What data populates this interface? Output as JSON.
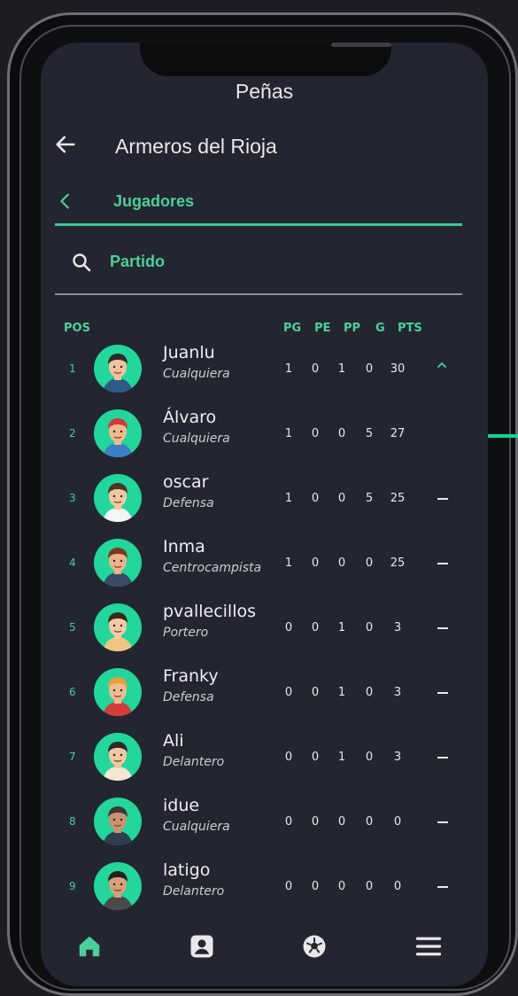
{
  "app": {
    "title": "Peñas",
    "club_name": "Armeros del Rioja"
  },
  "tabs": {
    "active_label": "Jugadores"
  },
  "search": {
    "value": "Partido"
  },
  "table": {
    "columns": {
      "pos": "POS",
      "pg": "PG",
      "pe": "PE",
      "pp": "PP",
      "g": "G",
      "pts": "PTS"
    },
    "rows": [
      {
        "pos": "1",
        "name": "Juanlu",
        "role": "Cualquiera",
        "pg": "1",
        "pe": "0",
        "pp": "1",
        "g": "0",
        "pts": "30",
        "trend": "up"
      },
      {
        "pos": "2",
        "name": "Álvaro",
        "role": "Cualquiera",
        "pg": "1",
        "pe": "0",
        "pp": "0",
        "g": "5",
        "pts": "27",
        "trend": "none"
      },
      {
        "pos": "3",
        "name": "oscar",
        "role": "Defensa",
        "pg": "1",
        "pe": "0",
        "pp": "0",
        "g": "5",
        "pts": "25",
        "trend": "same"
      },
      {
        "pos": "4",
        "name": "Inma",
        "role": "Centrocampista",
        "pg": "1",
        "pe": "0",
        "pp": "0",
        "g": "0",
        "pts": "25",
        "trend": "same"
      },
      {
        "pos": "5",
        "name": "pvallecillos",
        "role": "Portero",
        "pg": "0",
        "pe": "0",
        "pp": "1",
        "g": "0",
        "pts": "3",
        "trend": "same"
      },
      {
        "pos": "6",
        "name": "Franky",
        "role": "Defensa",
        "pg": "0",
        "pe": "0",
        "pp": "1",
        "g": "0",
        "pts": "3",
        "trend": "same"
      },
      {
        "pos": "7",
        "name": "Ali",
        "role": "Delantero",
        "pg": "0",
        "pe": "0",
        "pp": "1",
        "g": "0",
        "pts": "3",
        "trend": "same"
      },
      {
        "pos": "8",
        "name": "idue",
        "role": "Cualquiera",
        "pg": "0",
        "pe": "0",
        "pp": "0",
        "g": "0",
        "pts": "0",
        "trend": "same"
      },
      {
        "pos": "9",
        "name": "latigo",
        "role": "Delantero",
        "pg": "0",
        "pe": "0",
        "pp": "0",
        "g": "0",
        "pts": "0",
        "trend": "same"
      }
    ]
  },
  "colors": {
    "accent": "#4ccf99",
    "background": "#232630",
    "avatar_bg": "#23d69c"
  },
  "nav": {
    "items": [
      "home-icon",
      "player-icon",
      "soccer-ball-icon",
      "menu-icon"
    ],
    "active": "home-icon"
  }
}
